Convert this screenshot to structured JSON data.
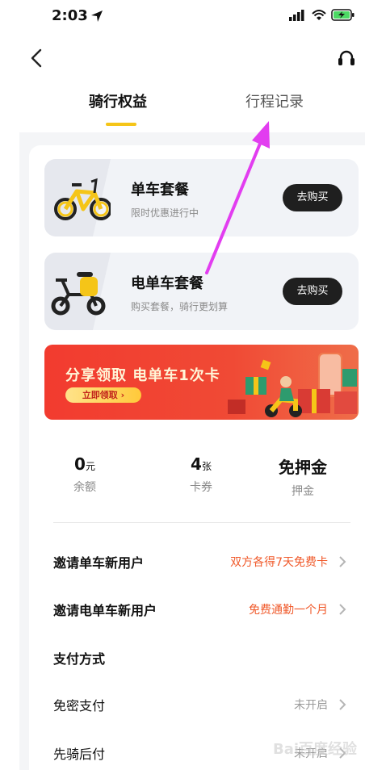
{
  "status_bar": {
    "time": "2:03"
  },
  "tabs": [
    {
      "label": "骑行权益",
      "active": true
    },
    {
      "label": "行程记录",
      "active": false
    }
  ],
  "plans": [
    {
      "title": "单车套餐",
      "subtitle": "限时优惠进行中",
      "button": "去购买",
      "icon": "bicycle-icon"
    },
    {
      "title": "电单车套餐",
      "subtitle": "购买套餐，骑行更划算",
      "button": "去购买",
      "icon": "ebike-icon"
    }
  ],
  "banner": {
    "title": "分享领取 电单车1次卡",
    "button": "立即领取 ›"
  },
  "stats": [
    {
      "value": "0",
      "unit": "元",
      "label": "余额"
    },
    {
      "value": "4",
      "unit": "张",
      "label": "卡券"
    },
    {
      "value": "免押金",
      "unit": "",
      "label": "押金"
    }
  ],
  "rows": [
    {
      "label": "邀请单车新用户",
      "value": "双方各得7天免费卡",
      "value_color": "#f0592a",
      "chevron": true
    },
    {
      "label": "邀请电单车新用户",
      "value": "免费通勤一个月",
      "value_color": "#f0592a",
      "chevron": true
    },
    {
      "label": "支付方式",
      "value": "",
      "chevron": false
    },
    {
      "label": "免密支付",
      "value": "未开启",
      "value_color": "#9a9a9a",
      "chevron": true
    },
    {
      "label": "先骑后付",
      "value": "未开启",
      "value_color": "#9a9a9a",
      "chevron": true
    }
  ],
  "watermark": {
    "text": "Bai百度经验"
  },
  "colors": {
    "accent": "#f5c518",
    "highlight_arrow": "#e23df0",
    "link_orange": "#f0592a"
  }
}
